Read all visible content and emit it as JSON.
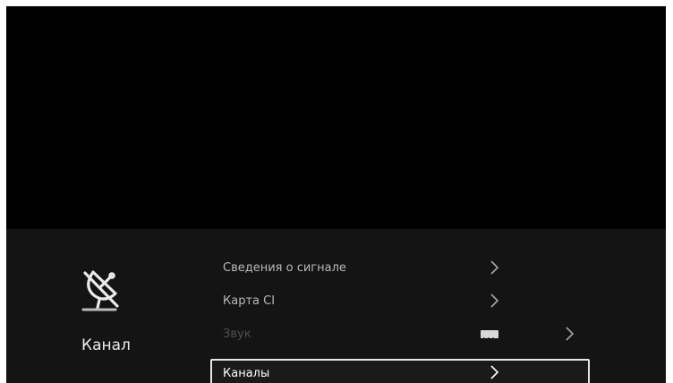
{
  "category": {
    "icon": "satellite-dish-off-icon",
    "label": "Канал"
  },
  "menu": {
    "items": [
      {
        "label": "Сведения о сигнале",
        "icon": "chevron-right-icon",
        "disabled": false,
        "selected": false
      },
      {
        "label": "Карта CI",
        "icon": "chevron-right-icon",
        "disabled": false,
        "selected": false
      },
      {
        "label": "Звук",
        "icon": "chevron-right-icon",
        "badge_icon": "audio-badge-icon",
        "disabled": true,
        "selected": false
      },
      {
        "label": "Каналы",
        "icon": "chevron-right-icon",
        "disabled": false,
        "selected": true
      }
    ]
  },
  "colors": {
    "background": "#000000",
    "panel": "#141414",
    "text": "#b9b9b9",
    "text_disabled": "#4e4e4e",
    "highlight_border": "#e6e6e6"
  }
}
